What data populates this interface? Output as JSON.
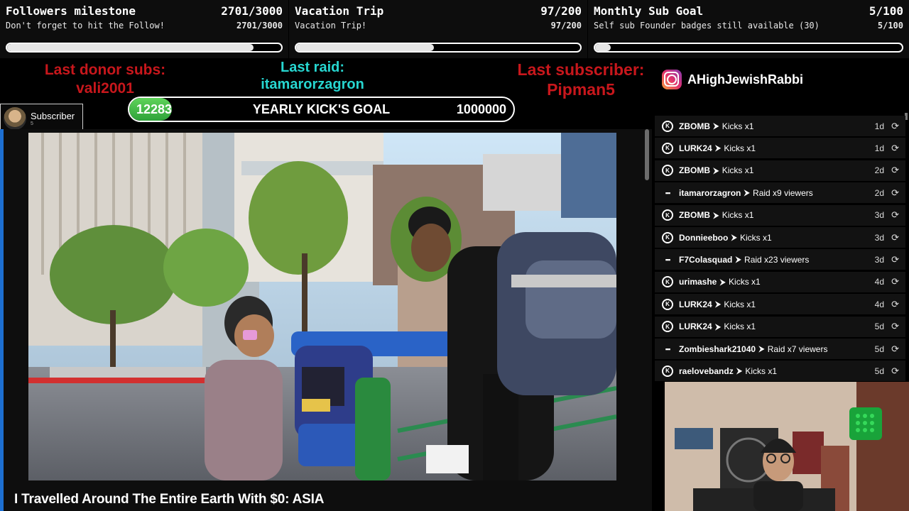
{
  "goals": [
    {
      "title": "Followers milestone",
      "count": "2701/3000",
      "subtitle": "Don't forget to hit the Follow!",
      "count2": "2701/3000",
      "progress": 0.9
    },
    {
      "title": "Vacation Trip",
      "count": "97/200",
      "subtitle": "Vacation Trip!",
      "count2": "97/200",
      "progress": 0.485
    },
    {
      "title": "Monthly Sub Goal",
      "count": "5/100",
      "subtitle": "Self sub Founder badges still available (30)",
      "count2": "5/100",
      "progress": 0.05
    }
  ],
  "last_donor": {
    "label": "Last donor subs:",
    "name": "vali2001"
  },
  "last_raid": {
    "label": "Last raid:",
    "name": "itamarorzagron"
  },
  "last_subscriber": {
    "label": "Last subscriber:",
    "name": "Pipman5"
  },
  "instagram": {
    "handle": "AHighJewishRabbi"
  },
  "yearly": {
    "current": "12283",
    "title": "YEARLY KICK'S GOAL",
    "goal": "1000000",
    "progress": 0.0123
  },
  "sub_badge": {
    "label": "Subscriber",
    "count": "5"
  },
  "video": {
    "title": "I Travelled Around The Entire Earth With $0: ASIA"
  },
  "feed": [
    {
      "icon": "kick",
      "user": "ZBOMB",
      "action": "Kicks x1",
      "ago": "1d"
    },
    {
      "icon": "kick",
      "user": "LURK24",
      "action": "Kicks x1",
      "ago": "1d"
    },
    {
      "icon": "kick",
      "user": "ZBOMB",
      "action": "Kicks x1",
      "ago": "2d"
    },
    {
      "icon": "raid",
      "user": "itamarorzagron",
      "action": "Raid x9 viewers",
      "ago": "2d"
    },
    {
      "icon": "kick",
      "user": "ZBOMB",
      "action": "Kicks x1",
      "ago": "3d"
    },
    {
      "icon": "kick",
      "user": "Donnieeboo",
      "action": "Kicks x1",
      "ago": "3d"
    },
    {
      "icon": "raid",
      "user": "F7Colasquad",
      "action": "Raid x23 viewers",
      "ago": "3d"
    },
    {
      "icon": "kick",
      "user": "urimashe",
      "action": "Kicks x1",
      "ago": "4d"
    },
    {
      "icon": "kick",
      "user": "LURK24",
      "action": "Kicks x1",
      "ago": "4d"
    },
    {
      "icon": "kick",
      "user": "LURK24",
      "action": "Kicks x1",
      "ago": "5d"
    },
    {
      "icon": "raid",
      "user": "Zombieshark21040",
      "action": "Raid x7 viewers",
      "ago": "5d"
    },
    {
      "icon": "kick",
      "user": "raelovebandz",
      "action": "Kicks x1",
      "ago": "5d"
    }
  ],
  "separator": "⮞",
  "replay_icon": "⟳"
}
